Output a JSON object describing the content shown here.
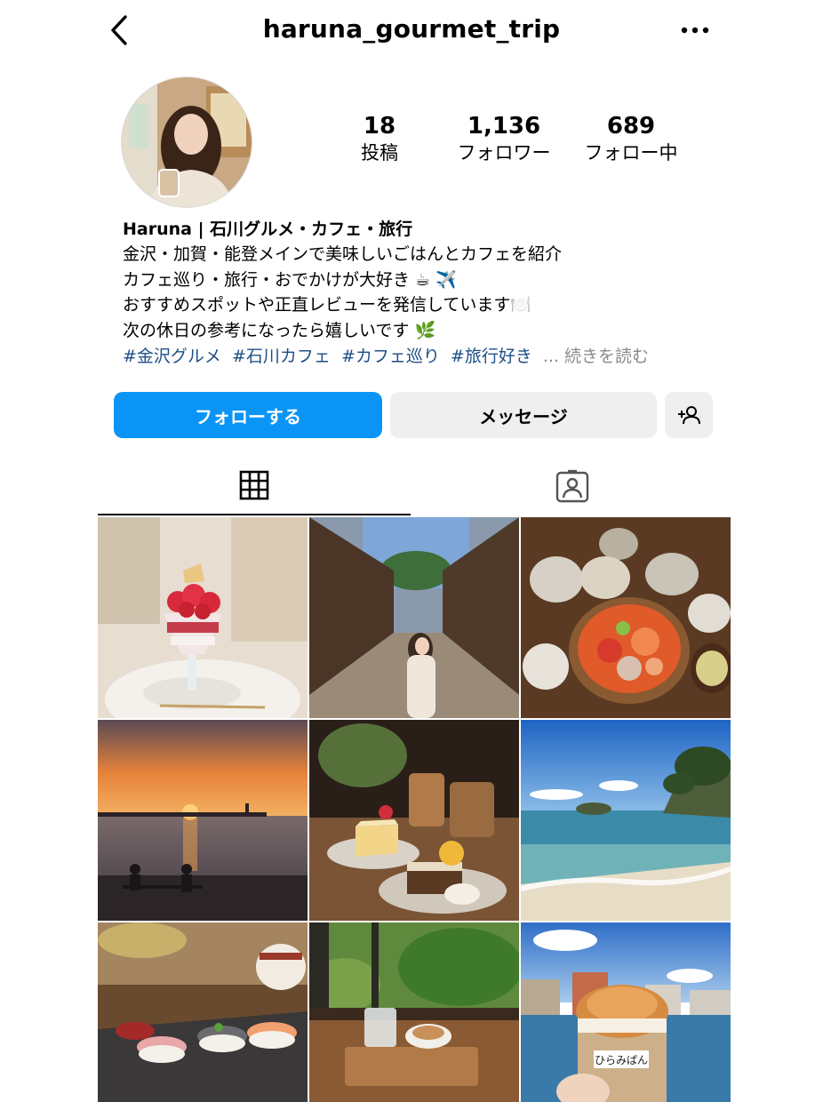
{
  "header": {
    "username": "haruna_gourmet_trip",
    "back_icon": "chevron-left-icon",
    "more_icon": "more-horizontal-icon"
  },
  "profile": {
    "stats": [
      {
        "value": "18",
        "label": "投稿"
      },
      {
        "value": "1,136",
        "label": "フォロワー"
      },
      {
        "value": "689",
        "label": "フォロー中"
      }
    ],
    "display_name": "Haruna | 石川グルメ・カフェ・旅行",
    "bio_lines": [
      "金沢・加賀・能登メインで美味しいごはんとカフェを紹介",
      "カフェ巡り・旅行・おでかけが大好き ☕ ✈️",
      "おすすめスポットや正直レビューを発信しています🍽️",
      "次の休日の参考になったら嬉しいです 🌿"
    ],
    "hashtags": [
      "#金沢グルメ",
      "#石川カフェ",
      "#カフェ巡り",
      "#旅行好き"
    ],
    "ellipsis": "...",
    "more_label": "続きを読む"
  },
  "actions": {
    "follow_label": "フォローする",
    "message_label": "メッセージ",
    "add_user_icon": "add-user-icon",
    "follow_color": "#0a95f6"
  },
  "tabs": [
    {
      "icon": "grid-icon",
      "active": true
    },
    {
      "icon": "tagged-person-icon",
      "active": false
    }
  ],
  "posts": [
    {
      "subject": "strawberry-parfait"
    },
    {
      "subject": "teahouse-street"
    },
    {
      "subject": "seafood-set-meal"
    },
    {
      "subject": "sunset-beach"
    },
    {
      "subject": "cafe-cake-coffee"
    },
    {
      "subject": "rocky-coast"
    },
    {
      "subject": "sushi"
    },
    {
      "subject": "garden-cafe-latte"
    },
    {
      "subject": "hiramipan-sandwich",
      "caption": "ひらみぱん"
    }
  ]
}
